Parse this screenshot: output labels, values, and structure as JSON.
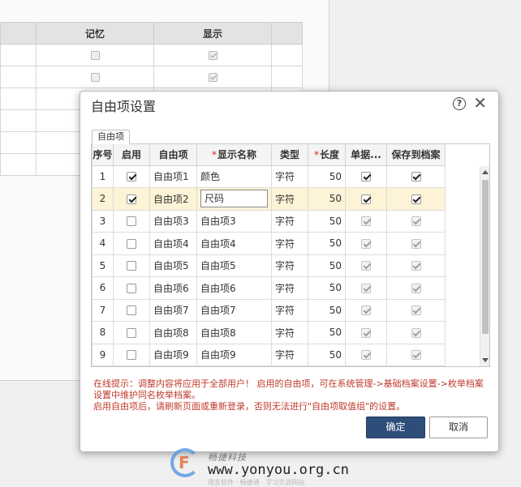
{
  "background": {
    "columns": [
      "记忆",
      "显示"
    ],
    "rows": [
      {
        "memory": false,
        "show": true
      },
      {
        "memory": false,
        "show": true
      },
      {
        "memory": false,
        "show": false
      },
      {
        "memory": false,
        "show": false
      },
      {
        "memory": false,
        "show": false
      },
      {
        "memory": false,
        "show": false
      }
    ]
  },
  "dialog": {
    "title": "自由项设置",
    "help_glyph": "?",
    "close_glyph": "✕",
    "tab_label": "自由项",
    "columns": [
      "序号",
      "启用",
      "自由项",
      "显示名称",
      "类型",
      "长度",
      "单据...",
      "保存到档案"
    ],
    "required_mark": "*",
    "rows": [
      {
        "seq": "1",
        "enabled": true,
        "item": "自由项1",
        "name": "颜色",
        "type": "字符",
        "length": "50",
        "doc": true,
        "save": true,
        "selected": false,
        "editing": false
      },
      {
        "seq": "2",
        "enabled": true,
        "item": "自由项2",
        "name": "尺码",
        "type": "字符",
        "length": "50",
        "doc": true,
        "save": true,
        "selected": true,
        "editing": true
      },
      {
        "seq": "3",
        "enabled": false,
        "item": "自由项3",
        "name": "自由项3",
        "type": "字符",
        "length": "50",
        "doc": true,
        "save": true,
        "selected": false,
        "editing": false
      },
      {
        "seq": "4",
        "enabled": false,
        "item": "自由项4",
        "name": "自由项4",
        "type": "字符",
        "length": "50",
        "doc": true,
        "save": true,
        "selected": false,
        "editing": false
      },
      {
        "seq": "5",
        "enabled": false,
        "item": "自由项5",
        "name": "自由项5",
        "type": "字符",
        "length": "50",
        "doc": true,
        "save": true,
        "selected": false,
        "editing": false
      },
      {
        "seq": "6",
        "enabled": false,
        "item": "自由项6",
        "name": "自由项6",
        "type": "字符",
        "length": "50",
        "doc": true,
        "save": true,
        "selected": false,
        "editing": false
      },
      {
        "seq": "7",
        "enabled": false,
        "item": "自由项7",
        "name": "自由项7",
        "type": "字符",
        "length": "50",
        "doc": true,
        "save": true,
        "selected": false,
        "editing": false
      },
      {
        "seq": "8",
        "enabled": false,
        "item": "自由项8",
        "name": "自由项8",
        "type": "字符",
        "length": "50",
        "doc": true,
        "save": true,
        "selected": false,
        "editing": false
      },
      {
        "seq": "9",
        "enabled": false,
        "item": "自由项9",
        "name": "自由项9",
        "type": "字符",
        "length": "50",
        "doc": true,
        "save": true,
        "selected": false,
        "editing": false
      }
    ],
    "hint_line1": "在线提示：调整内容将应用于全部用户！ 启用的自由项，可在系统管理->基础档案设置->枚举档案设置中维护同名枚举档案。",
    "hint_line2": "启用自由项后，请刷新页面或重新登录，否则无法进行\"自由项取值组\"的设置。",
    "ok_label": "确定",
    "cancel_label": "取消"
  },
  "watermark": {
    "logo_letter": "F",
    "site_cn": "畅捷科技",
    "url": "www.yonyou.org.cn",
    "tagline": "用友软件 · 畅捷通 · 学习交流网站"
  },
  "colors": {
    "selected_row": "#fdf3d6",
    "primary_button": "#2e4e7a",
    "hint_text": "#c0392b",
    "required_mark": "#e02020"
  }
}
